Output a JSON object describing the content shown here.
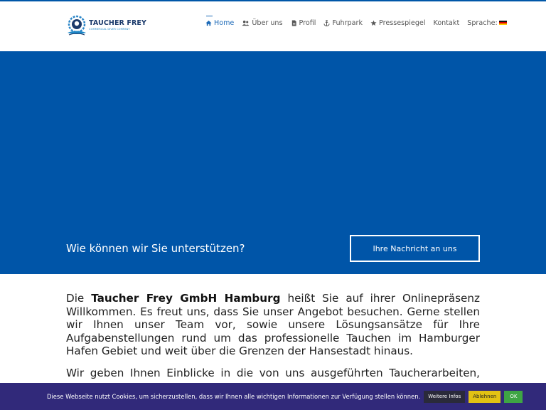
{
  "brand": {
    "name": "TAUCHER FREY",
    "tagline": "COMMERCIAL DIVER COMPANY"
  },
  "nav": {
    "items": [
      {
        "label": "Home",
        "icon": "home-icon",
        "active": true
      },
      {
        "label": "Über uns",
        "icon": "users-icon",
        "active": false
      },
      {
        "label": "Profil",
        "icon": "file-icon",
        "active": false
      },
      {
        "label": "Fuhrpark",
        "icon": "anchor-icon",
        "active": false
      },
      {
        "label": "Pressespiegel",
        "icon": "star-icon",
        "active": false
      },
      {
        "label": "Kontakt",
        "icon": "",
        "active": false
      }
    ],
    "language_label": "Sprache:",
    "language_flag": "german-flag-icon"
  },
  "hero": {
    "question": "Wie können wir Sie unterstützen?",
    "cta": "Ihre Nachricht an uns"
  },
  "content": {
    "intro_prefix": "Die ",
    "intro_company": "Taucher Frey GmbH Hamburg",
    "intro_rest": " heißt Sie auf ihrer Onlinepräsenz Willkommen. Es freut uns, dass Sie unser Angebot besuchen. Gerne stellen wir Ihnen unser Team vor, sowie unsere Lösungsansätze für Ihre Aufgabenstellungen rund um das professionelle Tauchen im Hamburger Hafen Gebiet und weit über die Grenzen der Hansestadt hinaus.",
    "second": "Wir geben Ihnen Einblicke in die von uns ausgeführten Taucherarbeiten, unsere"
  },
  "cookie": {
    "text": "Diese Webseite nutzt Cookies, um sicherzustellen, dass wir Ihnen alle wichtigen Informationen zur Verfügung stellen können.",
    "info": "Weitere Infos",
    "decline": "Ablehnen",
    "ok": "OK"
  },
  "colors": {
    "hero_bg": "#0055a8",
    "cookie_bg": "#31297a",
    "accent": "#1e6bb8",
    "decline_btn": "#e2c214",
    "ok_btn": "#3ea544"
  }
}
